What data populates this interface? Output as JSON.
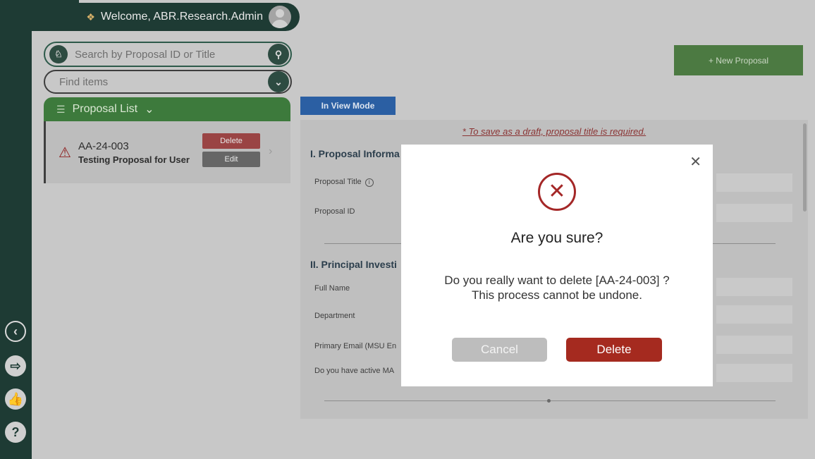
{
  "header": {
    "welcome": "Welcome, ABR.Research.Admin",
    "wave_icon": "waving-hand-icon",
    "avatar_icon": "user-avatar-icon"
  },
  "search": {
    "placeholder": "Search by Proposal ID or Title",
    "logo_icon": "spartan-logo-icon",
    "button_icon": "search-icon"
  },
  "find": {
    "placeholder": "Find items",
    "button_icon": "chevron-down-icon"
  },
  "proposal_list": {
    "title": "Proposal List",
    "items": [
      {
        "id": "AA-24-003",
        "title": "Testing Proposal for User",
        "delete_label": "Delete",
        "edit_label": "Edit",
        "status_icon": "warning-icon"
      }
    ]
  },
  "toolbar": {
    "new_proposal": "+ New Proposal",
    "view_mode": "In View Mode"
  },
  "form": {
    "draft_note": "* To save as a draft, proposal title is required.",
    "section1": "I. Proposal Informa",
    "proposal_title_label": "Proposal Title",
    "proposal_id_label": "Proposal ID",
    "section2": "II. Principal Investi",
    "full_name_label": "Full Name",
    "department_label": "Department",
    "primary_email_label": "Primary Email (MSU En",
    "active_label": "Do you have active MA"
  },
  "modal": {
    "heading": "Are you sure?",
    "message_line1": "Do you really want to delete [AA-24-003] ?",
    "message_line2": "This process cannot be undone.",
    "cancel_label": "Cancel",
    "delete_label": "Delete"
  },
  "rail": {
    "icons": [
      "back-arrow-icon",
      "logout-icon",
      "thumbs-up-icon",
      "help-icon"
    ]
  },
  "colors": {
    "brand_green": "#1e3b34",
    "accent_green": "#3d7a3c",
    "danger": "#a52a1f",
    "info_blue": "#2b5fa3"
  }
}
